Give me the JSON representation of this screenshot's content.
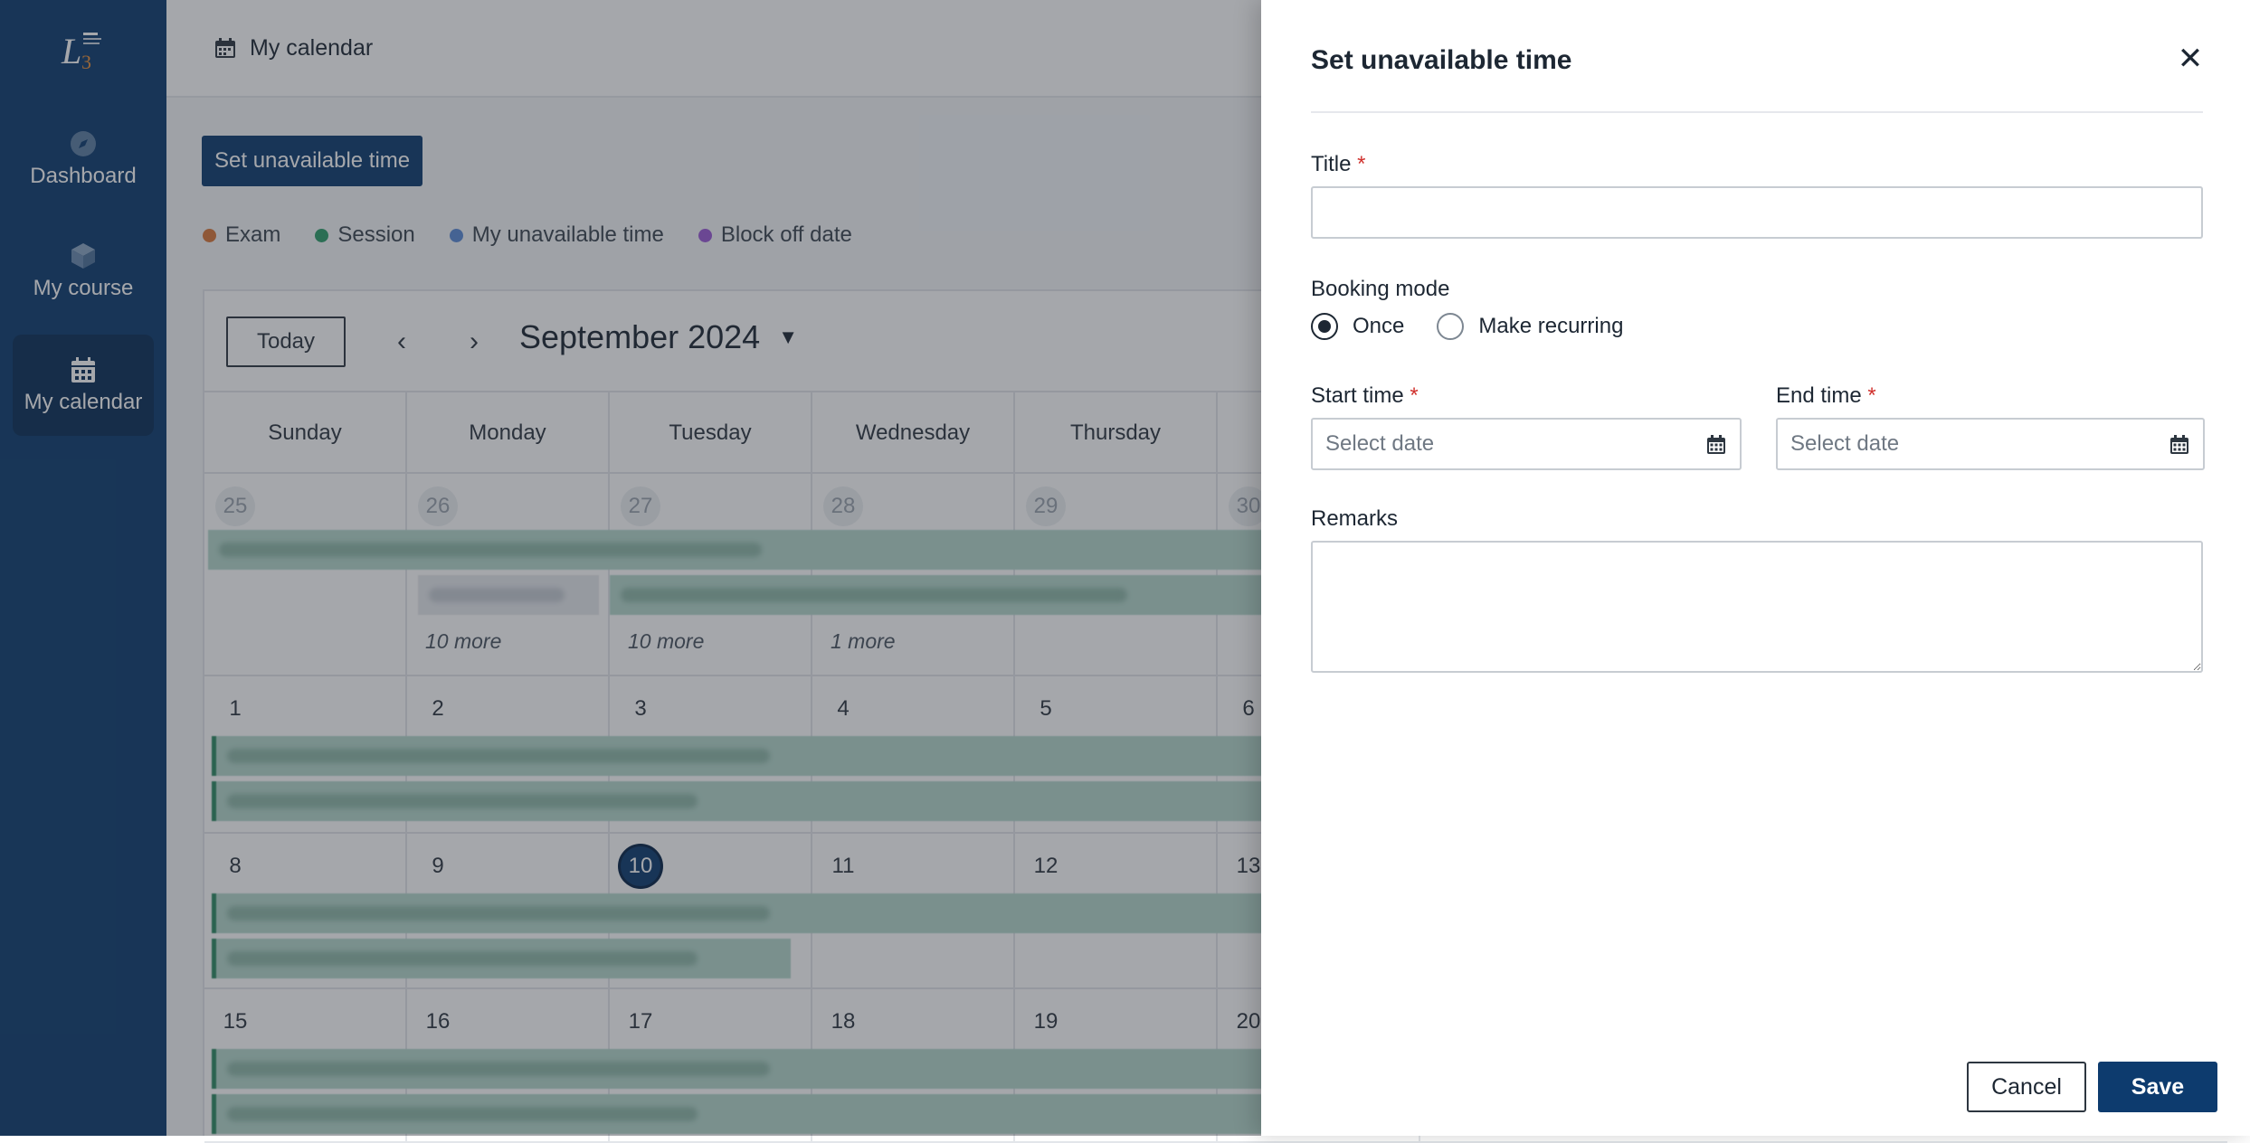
{
  "sidebar": {
    "logo_icon": "l3-logo",
    "items": [
      {
        "label": "Dashboard",
        "icon": "compass-icon",
        "active": false
      },
      {
        "label": "My course",
        "icon": "cube-icon",
        "active": false
      },
      {
        "label": "My calendar",
        "icon": "calendar-icon",
        "active": true
      }
    ]
  },
  "topbar": {
    "title": "My calendar",
    "icon": "calendar-icon"
  },
  "page": {
    "set_unavailable_label": "Set unavailable time",
    "legend": [
      {
        "label": "Exam",
        "color": "#d9783a"
      },
      {
        "label": "Session",
        "color": "#2e9e6a"
      },
      {
        "label": "My unavailable time",
        "color": "#5b8bd6"
      },
      {
        "label": "Block off date",
        "color": "#9c5bd6"
      }
    ]
  },
  "calendar": {
    "today_label": "Today",
    "prev_icon": "chevron-left-icon",
    "next_icon": "chevron-right-icon",
    "month_label": "September 2024",
    "weekdays": [
      "Sunday",
      "Monday",
      "Tuesday",
      "Wednesday",
      "Thursday"
    ],
    "weeks": [
      {
        "days": [
          "25",
          "26",
          "27",
          "28",
          "29",
          "30"
        ],
        "muted": true,
        "more": [
          "",
          "10 more",
          "10 more",
          "1 more",
          "",
          ""
        ]
      },
      {
        "days": [
          "1",
          "2",
          "3",
          "4",
          "5",
          "6"
        ],
        "muted": false
      },
      {
        "days": [
          "8",
          "9",
          "10",
          "11",
          "12",
          "13"
        ],
        "muted": false,
        "today": "10"
      },
      {
        "days": [
          "15",
          "16",
          "17",
          "18",
          "19",
          "20"
        ],
        "muted": false
      }
    ]
  },
  "drawer": {
    "title": "Set unavailable time",
    "close_icon": "close-icon",
    "title_field": {
      "label": "Title",
      "required_mark": "*",
      "value": "",
      "placeholder": ""
    },
    "booking_mode": {
      "label": "Booking mode",
      "options": [
        {
          "label": "Once",
          "selected": true
        },
        {
          "label": "Make recurring",
          "selected": false
        }
      ]
    },
    "start_time": {
      "label": "Start time",
      "required_mark": "*",
      "placeholder": "Select date"
    },
    "end_time": {
      "label": "End time",
      "required_mark": "*",
      "placeholder": "Select date"
    },
    "remarks": {
      "label": "Remarks",
      "value": ""
    },
    "cancel_label": "Cancel",
    "save_label": "Save"
  }
}
